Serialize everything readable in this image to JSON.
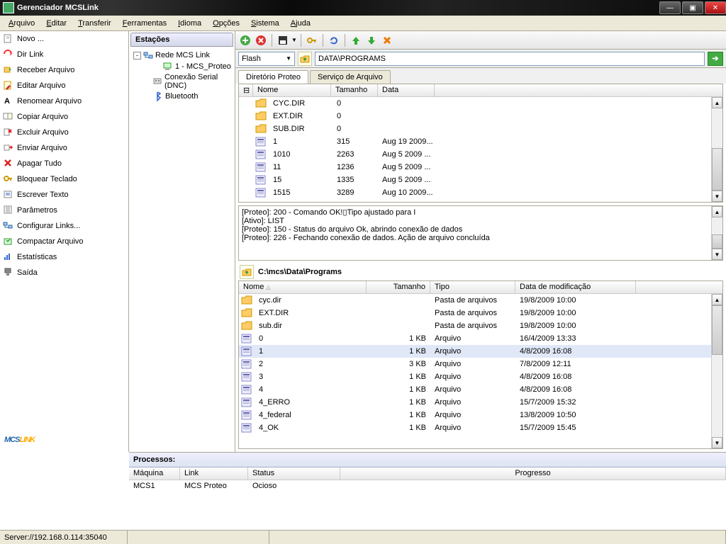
{
  "window": {
    "title": "Gerenciador MCSLink"
  },
  "menu": [
    "Arquivo",
    "Editar",
    "Transferir",
    "Ferramentas",
    "Idioma",
    "Opções",
    "Sistema",
    "Ajuda"
  ],
  "menu_underline": [
    0,
    0,
    0,
    0,
    0,
    0,
    0,
    0
  ],
  "sidebar": {
    "items": [
      {
        "label": "Novo ..."
      },
      {
        "label": "Dir Link"
      },
      {
        "label": "Receber Arquivo"
      },
      {
        "label": "Editar Arquivo"
      },
      {
        "label": "Renomear Arquivo"
      },
      {
        "label": "Copiar Arquivo"
      },
      {
        "label": "Excluir Arquivo"
      },
      {
        "label": "Enviar Arquivo"
      },
      {
        "label": "Apagar Tudo"
      },
      {
        "label": "Bloquear Teclado"
      },
      {
        "label": "Escrever Texto"
      },
      {
        "label": "Parâmetros"
      },
      {
        "label": "Configurar Links..."
      },
      {
        "label": "Compactar Arquivo"
      },
      {
        "label": "Estatísticas"
      },
      {
        "label": "Saída"
      }
    ]
  },
  "stations": {
    "header": "Estações",
    "tree": [
      {
        "label": "Rede MCS Link",
        "level": 0,
        "exp": "-"
      },
      {
        "label": "1 - MCS_Proteo",
        "level": 1,
        "exp": ""
      },
      {
        "label": "Conexão Serial (DNC)",
        "level": 0,
        "exp": ""
      },
      {
        "label": "Bluetooth",
        "level": 0,
        "exp": ""
      }
    ]
  },
  "pathbar": {
    "combo": "Flash",
    "path": "DATA\\PROGRAMS"
  },
  "tabs": [
    "Diretório Proteo",
    "Serviço de Arquivo"
  ],
  "remote_cols": {
    "name": "Nome",
    "size": "Tamanho",
    "date": "Data"
  },
  "remote_files": [
    {
      "icon": "folder",
      "name": "CYC.DIR",
      "size": "0",
      "date": ""
    },
    {
      "icon": "folder",
      "name": "EXT.DIR",
      "size": "0",
      "date": ""
    },
    {
      "icon": "folder",
      "name": "SUB.DIR",
      "size": "0",
      "date": ""
    },
    {
      "icon": "file",
      "name": "1",
      "size": "315",
      "date": "Aug 19 2009..."
    },
    {
      "icon": "file",
      "name": "1010",
      "size": "2263",
      "date": "Aug 5 2009 ..."
    },
    {
      "icon": "file",
      "name": "11",
      "size": "1236",
      "date": "Aug 5 2009 ..."
    },
    {
      "icon": "file",
      "name": "15",
      "size": "1335",
      "date": "Aug 5 2009 ..."
    },
    {
      "icon": "file",
      "name": "1515",
      "size": "3289",
      "date": "Aug 10 2009..."
    }
  ],
  "log_lines": [
    "[Proteo]: 200 - Comando OK!▯Tipo ajustado para I",
    "[Ativo]: LIST",
    "[Proteo]: 150 - Status do arquivo Ok, abrindo conexão de dados",
    "[Proteo]: 226 - Fechando conexão de dados. Ação de arquivo concluída"
  ],
  "local_path": "C:\\mcs\\Data\\Programs",
  "local_cols": {
    "name": "Nome",
    "size": "Tamanho",
    "type": "Tipo",
    "date": "Data de modificação"
  },
  "local_files": [
    {
      "icon": "folder",
      "name": "cyc.dir",
      "size": "",
      "type": "Pasta de arquivos",
      "date": "19/8/2009 10:00"
    },
    {
      "icon": "folder",
      "name": "EXT.DIR",
      "size": "",
      "type": "Pasta de arquivos",
      "date": "19/8/2009 10:00"
    },
    {
      "icon": "folder",
      "name": "sub.dir",
      "size": "",
      "type": "Pasta de arquivos",
      "date": "19/8/2009 10:00"
    },
    {
      "icon": "file",
      "name": "0",
      "size": "1 KB",
      "type": "Arquivo",
      "date": "16/4/2009 13:33"
    },
    {
      "icon": "file",
      "name": "1",
      "size": "1 KB",
      "type": "Arquivo",
      "date": "4/8/2009 16:08",
      "sel": true
    },
    {
      "icon": "file",
      "name": "2",
      "size": "3 KB",
      "type": "Arquivo",
      "date": "7/8/2009 12:11"
    },
    {
      "icon": "file",
      "name": "3",
      "size": "1 KB",
      "type": "Arquivo",
      "date": "4/8/2009 16:08"
    },
    {
      "icon": "file",
      "name": "4",
      "size": "1 KB",
      "type": "Arquivo",
      "date": "4/8/2009 16:08"
    },
    {
      "icon": "file",
      "name": "4_ERRO",
      "size": "1 KB",
      "type": "Arquivo",
      "date": "15/7/2009 15:32"
    },
    {
      "icon": "file",
      "name": "4_federal",
      "size": "1 KB",
      "type": "Arquivo",
      "date": "13/8/2009 10:50"
    },
    {
      "icon": "file",
      "name": "4_OK",
      "size": "1 KB",
      "type": "Arquivo",
      "date": "15/7/2009 15:45"
    }
  ],
  "proc": {
    "header": "Processos:",
    "cols": {
      "machine": "Máquina",
      "link": "Link",
      "status": "Status",
      "progress": "Progresso"
    },
    "row": {
      "machine": "MCS1",
      "link": "MCS Proteo",
      "status": "Ocioso",
      "progress": ""
    }
  },
  "status": "Server://192.168.0.114:35040"
}
